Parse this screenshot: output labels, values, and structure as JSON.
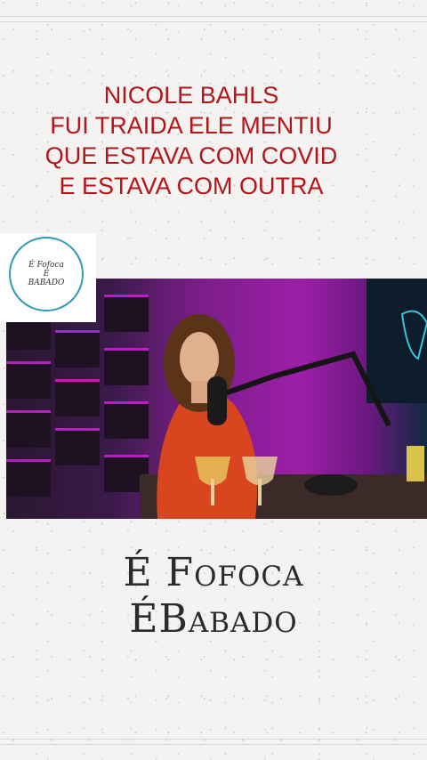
{
  "headline": {
    "lines": [
      "NICOLE BAHLS",
      "FUI TRAIDA ELE MENTIU",
      "QUE ESTAVA COM COVID",
      "E ESTAVA COM OUTRA"
    ]
  },
  "logo": {
    "line1": "É Fofoca",
    "line2": "É",
    "line3": "BABADO"
  },
  "brand": {
    "line1": "É Fofoca",
    "line2": "ÉBabado"
  },
  "colors": {
    "headline": "#b3151a",
    "logo_ring": "#2f9bb3",
    "brand": "#2b2b2b"
  }
}
